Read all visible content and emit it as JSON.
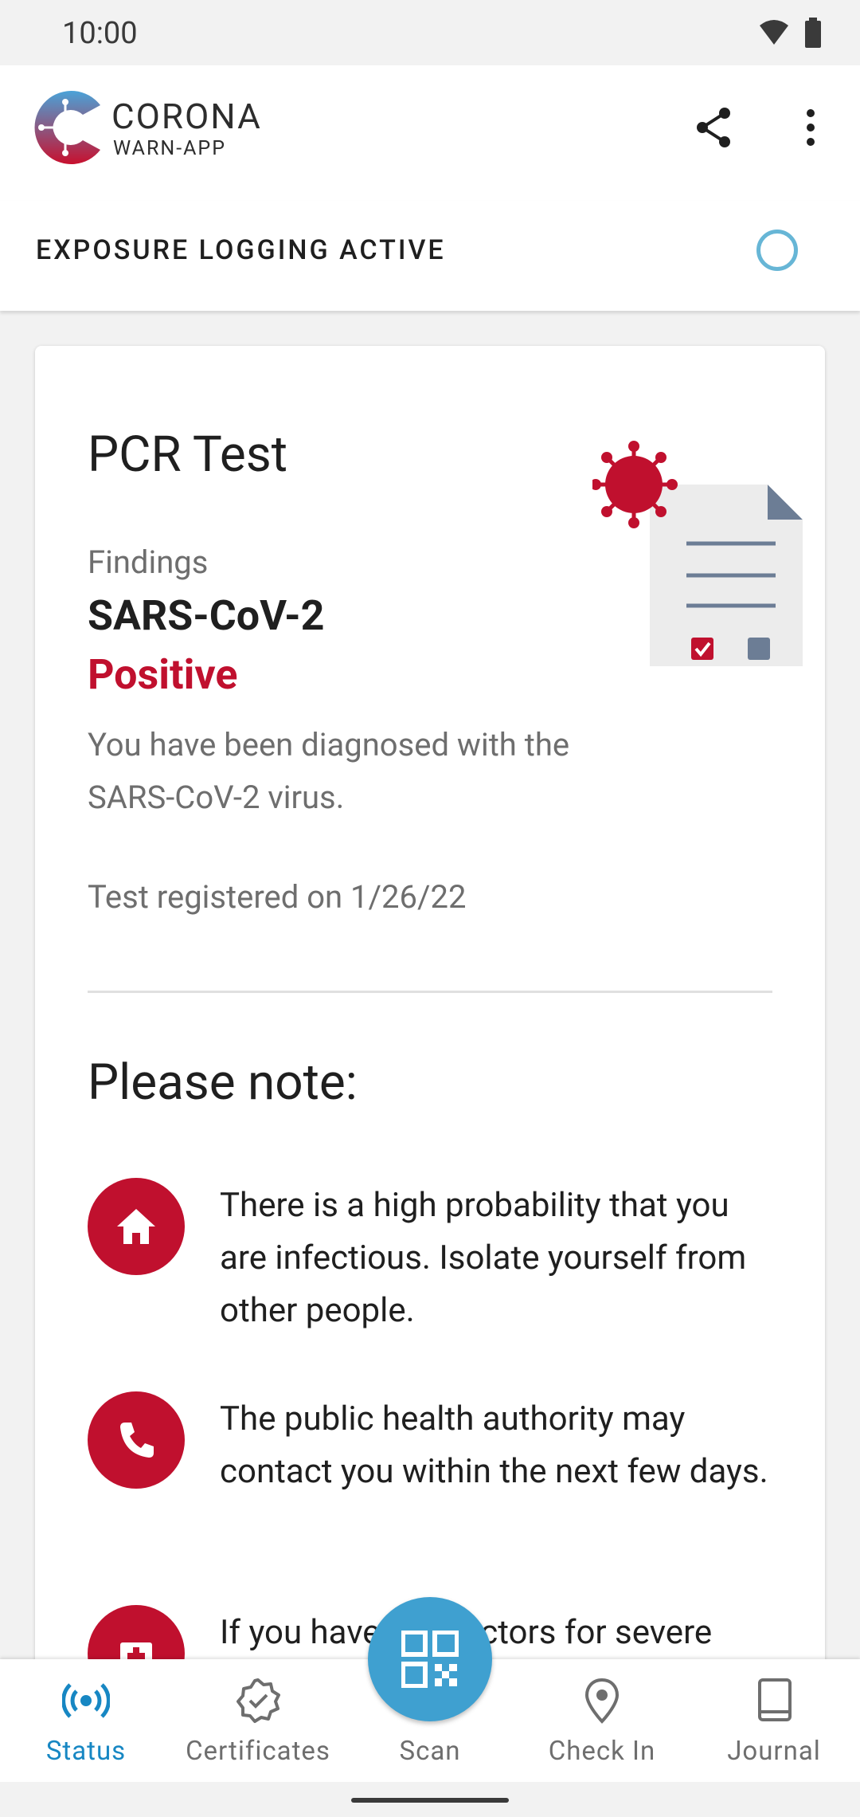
{
  "status_bar": {
    "time": "10:00"
  },
  "app_bar": {
    "logo_line1": "CORONA",
    "logo_line2": "WARN-APP"
  },
  "exposure": {
    "label": "EXPOSURE LOGGING ACTIVE"
  },
  "card": {
    "title": "PCR Test",
    "findings_label": "Findings",
    "virus": "SARS-CoV-2",
    "result": "Positive",
    "description": "You have been diagnosed with the SARS-CoV-2 virus.",
    "registered": "Test registered on 1/26/22",
    "note_title": "Please note:",
    "notes": [
      {
        "icon": "home-icon",
        "text": "There is a high probability that you are infectious. Isolate yourself from other people."
      },
      {
        "icon": "phone-icon",
        "text": "The public health authority may contact you within the next few days."
      },
      {
        "icon": "medical-cross-icon",
        "text": "If you have risk factors for severe"
      }
    ]
  },
  "bottom_nav": {
    "items": [
      {
        "label": "Status",
        "icon": "broadcast-icon",
        "active": true
      },
      {
        "label": "Certificates",
        "icon": "certificate-badge-icon"
      },
      {
        "label": "Scan",
        "icon": "qr-code-icon"
      },
      {
        "label": "Check In",
        "icon": "location-pin-icon"
      },
      {
        "label": "Journal",
        "icon": "book-icon"
      }
    ]
  },
  "colors": {
    "accent_red": "#c0102e",
    "accent_blue": "#1787c3",
    "fab_blue": "#3fa0d0"
  }
}
